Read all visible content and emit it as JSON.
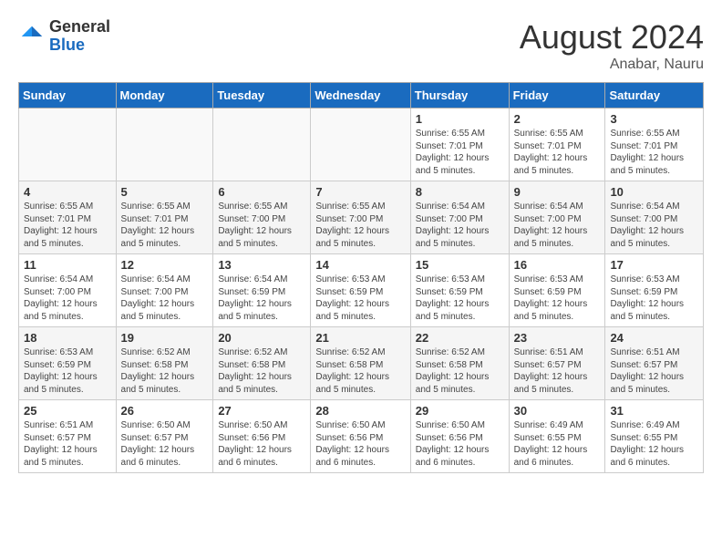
{
  "header": {
    "logo_general": "General",
    "logo_blue": "Blue",
    "month_year": "August 2024",
    "location": "Anabar, Nauru"
  },
  "weekdays": [
    "Sunday",
    "Monday",
    "Tuesday",
    "Wednesday",
    "Thursday",
    "Friday",
    "Saturday"
  ],
  "weeks": [
    [
      {
        "day": "",
        "content": ""
      },
      {
        "day": "",
        "content": ""
      },
      {
        "day": "",
        "content": ""
      },
      {
        "day": "",
        "content": ""
      },
      {
        "day": "1",
        "content": "Sunrise: 6:55 AM\nSunset: 7:01 PM\nDaylight: 12 hours\nand 5 minutes."
      },
      {
        "day": "2",
        "content": "Sunrise: 6:55 AM\nSunset: 7:01 PM\nDaylight: 12 hours\nand 5 minutes."
      },
      {
        "day": "3",
        "content": "Sunrise: 6:55 AM\nSunset: 7:01 PM\nDaylight: 12 hours\nand 5 minutes."
      }
    ],
    [
      {
        "day": "4",
        "content": "Sunrise: 6:55 AM\nSunset: 7:01 PM\nDaylight: 12 hours\nand 5 minutes."
      },
      {
        "day": "5",
        "content": "Sunrise: 6:55 AM\nSunset: 7:01 PM\nDaylight: 12 hours\nand 5 minutes."
      },
      {
        "day": "6",
        "content": "Sunrise: 6:55 AM\nSunset: 7:00 PM\nDaylight: 12 hours\nand 5 minutes."
      },
      {
        "day": "7",
        "content": "Sunrise: 6:55 AM\nSunset: 7:00 PM\nDaylight: 12 hours\nand 5 minutes."
      },
      {
        "day": "8",
        "content": "Sunrise: 6:54 AM\nSunset: 7:00 PM\nDaylight: 12 hours\nand 5 minutes."
      },
      {
        "day": "9",
        "content": "Sunrise: 6:54 AM\nSunset: 7:00 PM\nDaylight: 12 hours\nand 5 minutes."
      },
      {
        "day": "10",
        "content": "Sunrise: 6:54 AM\nSunset: 7:00 PM\nDaylight: 12 hours\nand 5 minutes."
      }
    ],
    [
      {
        "day": "11",
        "content": "Sunrise: 6:54 AM\nSunset: 7:00 PM\nDaylight: 12 hours\nand 5 minutes."
      },
      {
        "day": "12",
        "content": "Sunrise: 6:54 AM\nSunset: 7:00 PM\nDaylight: 12 hours\nand 5 minutes."
      },
      {
        "day": "13",
        "content": "Sunrise: 6:54 AM\nSunset: 6:59 PM\nDaylight: 12 hours\nand 5 minutes."
      },
      {
        "day": "14",
        "content": "Sunrise: 6:53 AM\nSunset: 6:59 PM\nDaylight: 12 hours\nand 5 minutes."
      },
      {
        "day": "15",
        "content": "Sunrise: 6:53 AM\nSunset: 6:59 PM\nDaylight: 12 hours\nand 5 minutes."
      },
      {
        "day": "16",
        "content": "Sunrise: 6:53 AM\nSunset: 6:59 PM\nDaylight: 12 hours\nand 5 minutes."
      },
      {
        "day": "17",
        "content": "Sunrise: 6:53 AM\nSunset: 6:59 PM\nDaylight: 12 hours\nand 5 minutes."
      }
    ],
    [
      {
        "day": "18",
        "content": "Sunrise: 6:53 AM\nSunset: 6:59 PM\nDaylight: 12 hours\nand 5 minutes."
      },
      {
        "day": "19",
        "content": "Sunrise: 6:52 AM\nSunset: 6:58 PM\nDaylight: 12 hours\nand 5 minutes."
      },
      {
        "day": "20",
        "content": "Sunrise: 6:52 AM\nSunset: 6:58 PM\nDaylight: 12 hours\nand 5 minutes."
      },
      {
        "day": "21",
        "content": "Sunrise: 6:52 AM\nSunset: 6:58 PM\nDaylight: 12 hours\nand 5 minutes."
      },
      {
        "day": "22",
        "content": "Sunrise: 6:52 AM\nSunset: 6:58 PM\nDaylight: 12 hours\nand 5 minutes."
      },
      {
        "day": "23",
        "content": "Sunrise: 6:51 AM\nSunset: 6:57 PM\nDaylight: 12 hours\nand 5 minutes."
      },
      {
        "day": "24",
        "content": "Sunrise: 6:51 AM\nSunset: 6:57 PM\nDaylight: 12 hours\nand 5 minutes."
      }
    ],
    [
      {
        "day": "25",
        "content": "Sunrise: 6:51 AM\nSunset: 6:57 PM\nDaylight: 12 hours\nand 5 minutes."
      },
      {
        "day": "26",
        "content": "Sunrise: 6:50 AM\nSunset: 6:57 PM\nDaylight: 12 hours\nand 6 minutes."
      },
      {
        "day": "27",
        "content": "Sunrise: 6:50 AM\nSunset: 6:56 PM\nDaylight: 12 hours\nand 6 minutes."
      },
      {
        "day": "28",
        "content": "Sunrise: 6:50 AM\nSunset: 6:56 PM\nDaylight: 12 hours\nand 6 minutes."
      },
      {
        "day": "29",
        "content": "Sunrise: 6:50 AM\nSunset: 6:56 PM\nDaylight: 12 hours\nand 6 minutes."
      },
      {
        "day": "30",
        "content": "Sunrise: 6:49 AM\nSunset: 6:55 PM\nDaylight: 12 hours\nand 6 minutes."
      },
      {
        "day": "31",
        "content": "Sunrise: 6:49 AM\nSunset: 6:55 PM\nDaylight: 12 hours\nand 6 minutes."
      }
    ]
  ]
}
